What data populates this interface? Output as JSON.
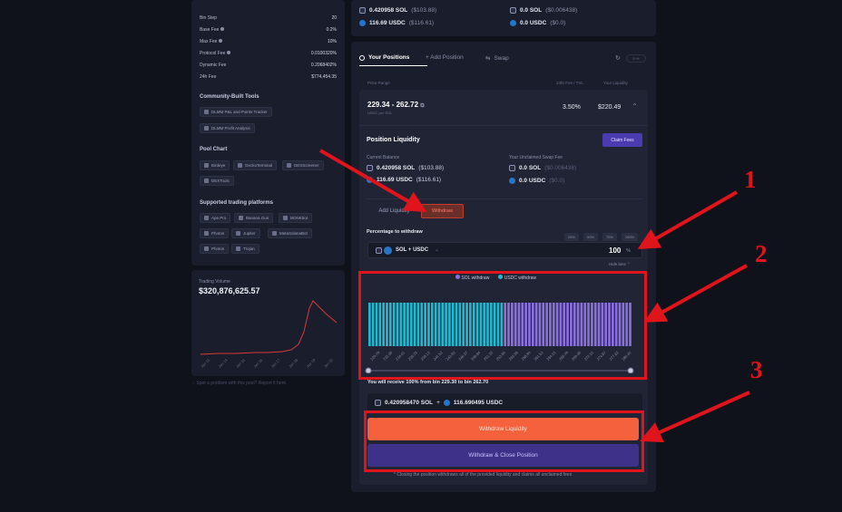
{
  "pool_stats": [
    {
      "label": "Bin Step",
      "value": "20"
    },
    {
      "label": "Base Fee",
      "value": "0.2%"
    },
    {
      "label": "Max Fee",
      "value": "10%"
    },
    {
      "label": "Protocol Fee",
      "value": "0.0100320%"
    },
    {
      "label": "Dynamic Fee",
      "value": "0.2068402%"
    },
    {
      "label": "24h Fee",
      "value": "$774,454.35"
    }
  ],
  "community": {
    "title": "Community-Built Tools",
    "items": [
      "DLMM P&L and Points Tracker",
      "DLMM Profit Analysis"
    ]
  },
  "pool_chart": {
    "title": "Pool Chart",
    "items": [
      "Birdeye",
      "GeckoTerminal",
      "DEXScreener",
      "DEXTools"
    ]
  },
  "platforms": {
    "title": "Supported trading platforms",
    "items": [
      "Ape.Pro",
      "Banana Gun",
      "BONKbot",
      "Photon",
      "Jupiter",
      "MetaSolanaBot",
      "Photon",
      "Trojan"
    ]
  },
  "volume": {
    "label": "Trading Volume",
    "value": "$320,876,625.57",
    "x_ticks": [
      "Jan 13",
      "Jan 14",
      "Jan 15",
      "Jan 16",
      "Jan 17",
      "Jan 18",
      "Jan 19",
      "Jan 20"
    ],
    "line_color": "#d63a3a"
  },
  "report_text": "Spot a problem with this pool? Report it here.",
  "top_balance": {
    "sol": "0.420958 SOL",
    "sol_usd": "($103.88)",
    "usdc": "116.69 USDC",
    "usdc_usd": "($116.61)",
    "fee_sol": "0.0 SOL",
    "fee_sol_usd": "($0.006438)",
    "fee_usdc": "0.0 USDC",
    "fee_usdc_usd": "($0.0)"
  },
  "tabs": {
    "positions": "Your Positions",
    "add": "+ Add Position",
    "swap": "Swap",
    "refresh_badge": "5 %"
  },
  "table_headers": {
    "range": "Price Range",
    "fee_tvl": "24hr Fee / TVL",
    "liquidity": "Your Liquidity"
  },
  "position": {
    "range": "229.34 - 262.72",
    "unit": "USDC per SOL",
    "fee_tvl": "3.50%",
    "liquidity": "$220.49",
    "section_title": "Position Liquidity",
    "claim_label": "Claim Fees",
    "current_balance_label": "Current Balance",
    "bal_sol": "0.420958 SOL",
    "bal_sol_usd": "($103.88)",
    "bal_usdc": "116.69 USDC",
    "bal_usdc_usd": "($116.61)",
    "unclaimed_label": "Your Unclaimed Swap Fee",
    "unc_sol": "0.0 SOL",
    "unc_sol_usd": "($0.006438)",
    "unc_usdc": "0.0 USDC",
    "unc_usdc_usd": "($0.0)"
  },
  "actions": {
    "add_liquidity": "Add Liquidity",
    "withdraw": "Withdraw",
    "pct_label": "Percentage to withdraw",
    "pct_options": [
      "25%",
      "50%",
      "75%",
      "100%"
    ],
    "pair": "SOL + USDC",
    "pct_value": "100",
    "pct_unit": "%",
    "hide_bins": "Hide bins"
  },
  "chart_data": {
    "type": "bar",
    "series": [
      {
        "name": "SOL withdraw",
        "color": "#8b6fe0"
      },
      {
        "name": "USDC withdraw",
        "color": "#22b8cf"
      }
    ],
    "usdc_bins": 39,
    "sol_bins": 37,
    "tick_labels": [
      "229.79",
      "232.08",
      "234.41",
      "236.76",
      "239.13",
      "241.52",
      "243.93",
      "246.37",
      "248.84",
      "251.33",
      "253.84",
      "256.38",
      "258.94",
      "261.53",
      "264.15",
      "266.79",
      "269.46",
      "272.15",
      "274.87",
      "277.62",
      "280.40"
    ],
    "slider_range": [
      0,
      1
    ]
  },
  "receive": {
    "text": "You will receive 100% from bin 229.30 to bin 262.70",
    "sol": "0.420958470 SOL",
    "plus": "+",
    "usdc": "116.690495 USDC"
  },
  "buttons": {
    "withdraw_liquidity": "Withdraw Liquidity",
    "withdraw_close": "Withdraw & Close Position"
  },
  "footnote": "* Closing the position withdraws all of the provided liquidity and claims all unclaimed fees",
  "annotations": {
    "n1": "1",
    "n2": "2",
    "n3": "3",
    "color": "#e0141b"
  }
}
